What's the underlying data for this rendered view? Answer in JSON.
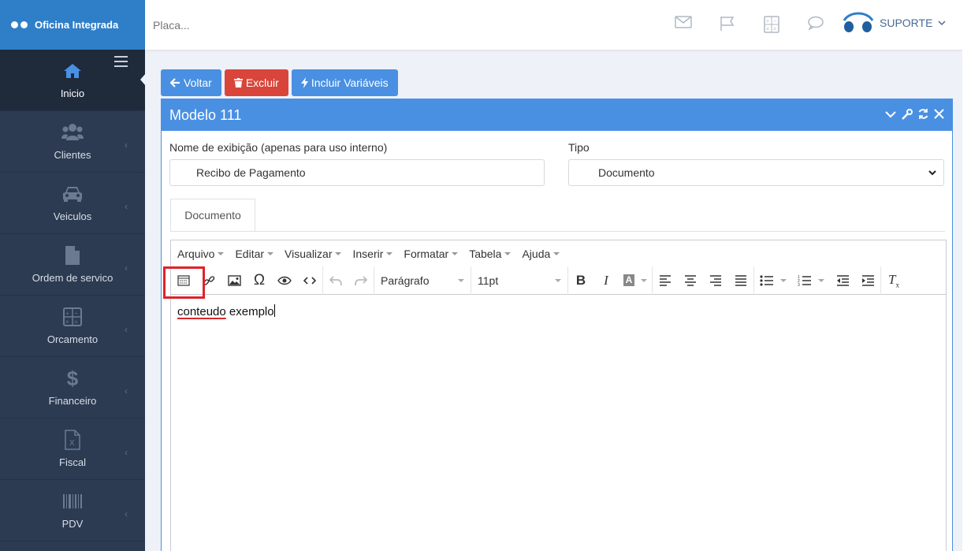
{
  "brand": {
    "name": "Oficina Integrada"
  },
  "sidebar": {
    "items": [
      {
        "label": "Inicio",
        "icon": "home-icon"
      },
      {
        "label": "Clientes",
        "icon": "users-icon"
      },
      {
        "label": "Veiculos",
        "icon": "car-icon"
      },
      {
        "label": "Ordem de servico",
        "icon": "file-icon"
      },
      {
        "label": "Orcamento",
        "icon": "calculator-icon"
      },
      {
        "label": "Financeiro",
        "icon": "dollar-icon"
      },
      {
        "label": "Fiscal",
        "icon": "file-excel-icon"
      },
      {
        "label": "PDV",
        "icon": "barcode-icon"
      }
    ]
  },
  "topbar": {
    "search_placeholder": "Placa...",
    "user": "SUPORTE"
  },
  "actions": {
    "back": "Voltar",
    "delete": "Excluir",
    "include_vars": "Incluir Variáveis"
  },
  "panel": {
    "title": "Modelo 111",
    "name_label": "Nome de exibição (apenas para uso interno)",
    "name_value": "Recibo de Pagamento",
    "type_label": "Tipo",
    "type_value": "Documento",
    "tab": "Documento"
  },
  "editor": {
    "menu": [
      "Arquivo",
      "Editar",
      "Visualizar",
      "Inserir",
      "Formatar",
      "Tabela",
      "Ajuda"
    ],
    "block_format": "Parágrafo",
    "font_size": "11pt",
    "content_word1": "conteudo",
    "content_word2": "exemplo"
  },
  "colors": {
    "primary": "#4a90e2",
    "danger": "#d9453a",
    "sidebar": "#2c3b51",
    "highlight": "#e0222b"
  }
}
